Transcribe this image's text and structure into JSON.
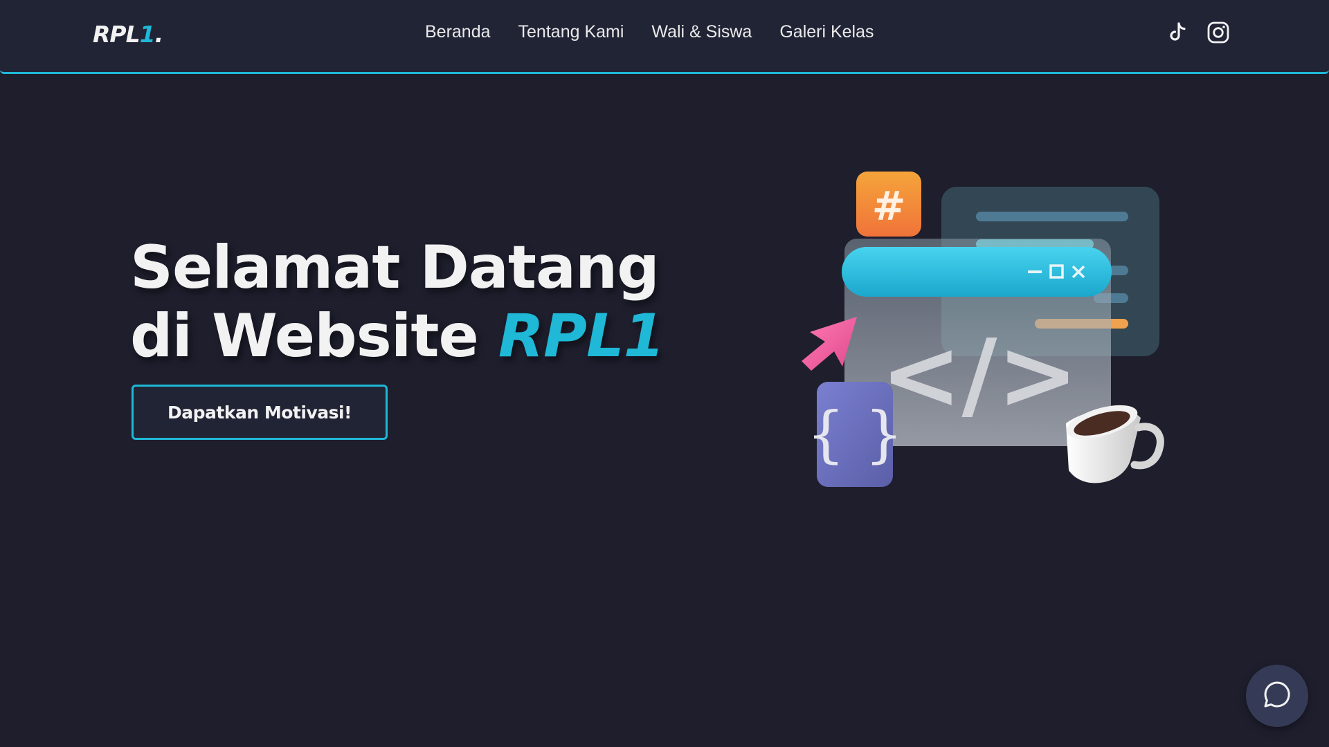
{
  "brand": {
    "logo_main": "RPL",
    "logo_accent": "1",
    "logo_dot": "."
  },
  "nav": {
    "items": [
      {
        "label": "Beranda"
      },
      {
        "label": "Tentang Kami"
      },
      {
        "label": "Wali & Siswa"
      },
      {
        "label": "Galeri Kelas"
      }
    ],
    "social": [
      {
        "icon": "tiktok-icon"
      },
      {
        "icon": "instagram-icon"
      }
    ]
  },
  "hero": {
    "title_line1": "Selamat Datang",
    "title_line2_prefix": "di Website ",
    "title_line2_accent": "RPL1",
    "cta_label": "Dapatkan Motivasi!"
  },
  "illustration": {
    "hash_symbol": "#",
    "braces_symbol": "{ }",
    "code_symbol": "</>"
  },
  "chat": {
    "icon": "chat-bubble-icon"
  },
  "colors": {
    "background": "#1e1e2d",
    "navbar": "#212435",
    "accent": "#1fb8d6",
    "text": "#f2f2f2"
  }
}
